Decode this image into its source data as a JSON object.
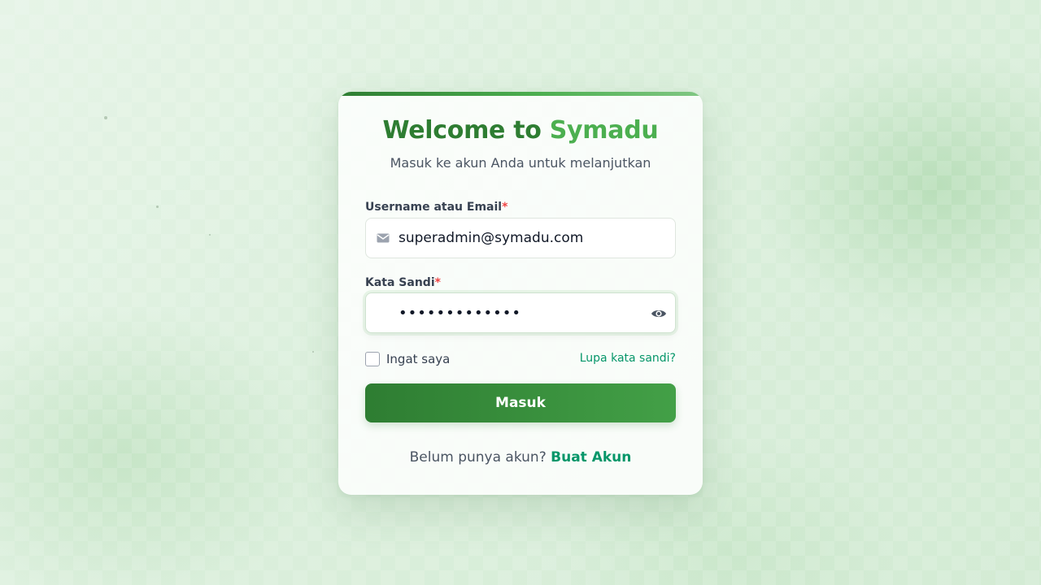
{
  "login": {
    "title_part1": "Welcome to",
    "title_part2": "Symadu",
    "subtitle": "Masuk ke akun Anda untuk melanjutkan",
    "username_label": "Username atau Email",
    "password_label": "Kata Sandi",
    "required_mark": "*",
    "username_value": "superadmin@symadu.com",
    "password_value": "•••••••••••••",
    "remember_label": "Ingat saya",
    "remember_checked": false,
    "forgot_link": "Lupa kata sandi?",
    "submit_label": "Masuk",
    "signup_prompt": "Belum punya akun?",
    "signup_link": "Buat Akun"
  },
  "icons": {
    "email": "mail-icon",
    "password_toggle": "eye-icon"
  },
  "colors": {
    "brand_dark": "#2e7d32",
    "brand_light": "#4caf50",
    "link": "#059669",
    "required": "#ef4444"
  }
}
